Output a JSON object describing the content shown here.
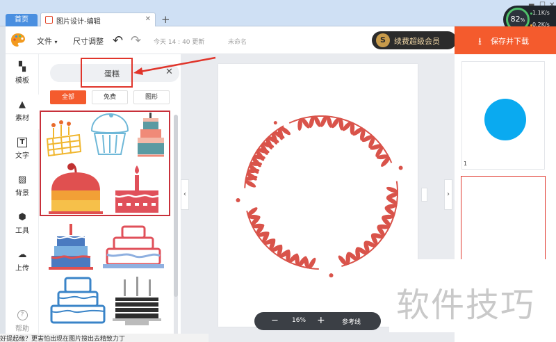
{
  "browser": {
    "home_tab": "首页",
    "active_tab": "图片设计-编辑",
    "new_tab": "+",
    "close_tab": "✕"
  },
  "system_widget": {
    "cpu_percent": "82",
    "cpu_unit": "%",
    "upload": "1.1K/s",
    "download": "0.2K/s"
  },
  "toolbar": {
    "file_menu": "文件",
    "resize_menu": "尺寸调整",
    "save_time": "今天 14 : 40 更新",
    "doc_name": "未命名",
    "vip_label": "续费超级会员",
    "save_download": "保存并下载"
  },
  "rail": {
    "items": [
      {
        "label": "模板",
        "icon": "template-icon"
      },
      {
        "label": "素材",
        "icon": "material-icon"
      },
      {
        "label": "文字",
        "icon": "text-icon"
      },
      {
        "label": "背景",
        "icon": "background-icon"
      },
      {
        "label": "工具",
        "icon": "tools-icon"
      },
      {
        "label": "上传",
        "icon": "upload-icon"
      }
    ],
    "help": "帮助"
  },
  "panel": {
    "search_value": "蛋糕",
    "filters": [
      "全部",
      "免费",
      "图形"
    ]
  },
  "canvas": {
    "zoom": "16%",
    "guide_label": "参考线"
  },
  "pages": {
    "first_page_number": "1"
  },
  "watermark": "软件技巧",
  "bottom_hint": "好提起缘？更害怕出现在图片搜出去精致力丁"
}
